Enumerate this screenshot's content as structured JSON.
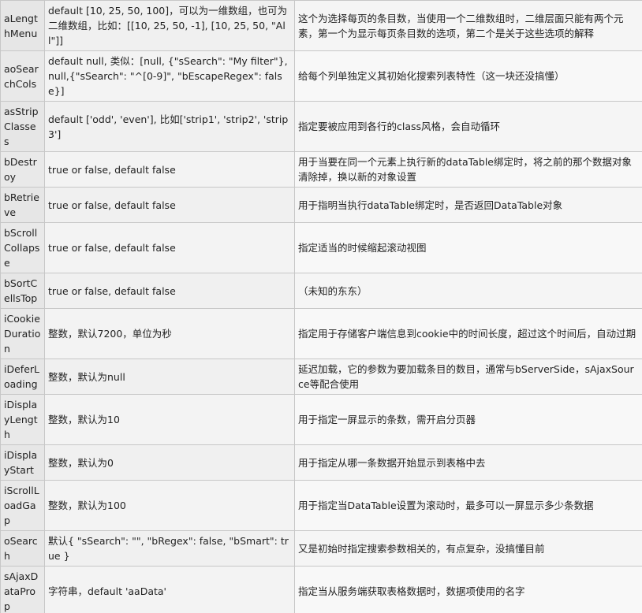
{
  "rows": [
    {
      "name": "aLengthMenu",
      "default": "default [10, 25, 50, 100]，可以为一维数组，也可为二维数组，比如：[[10, 25, 50, -1], [10, 25, 50, \"All\"]]",
      "desc": "这个为选择每页的条目数，当使用一个二维数组时，二维层面只能有两个元素，第一个为显示每页条目数的选项，第二个是关于这些选项的解释"
    },
    {
      "name": "aoSearchCols",
      "default": "default null, 类似：[null, {\"sSearch\": \"My filter\"}, null,{\"sSearch\": \"^[0-9]\", \"bEscapeRegex\": false}]",
      "desc": "给每个列单独定义其初始化搜索列表特性（这一块还没搞懂）"
    },
    {
      "name": "asStripClasses",
      "default": "default ['odd', 'even'], 比如['strip1', 'strip2', 'strip3']",
      "desc": "指定要被应用到各行的class风格，会自动循环"
    },
    {
      "name": "bDestroy",
      "default": "true or false, default false",
      "desc": "用于当要在同一个元素上执行新的dataTable绑定时，将之前的那个数据对象清除掉，换以新的对象设置"
    },
    {
      "name": "bRetrieve",
      "default": "true or false, default false",
      "desc": "用于指明当执行dataTable绑定时，是否返回DataTable对象"
    },
    {
      "name": "bScrollCollapse",
      "default": "true or false, default false",
      "desc": "指定适当的时候缩起滚动视图"
    },
    {
      "name": "bSortCellsTop",
      "default": "true or false, default false",
      "desc": "（未知的东东）"
    },
    {
      "name": "iCookieDuration",
      "default": "整数，默认7200，单位为秒",
      "desc": "指定用于存储客户端信息到cookie中的时间长度，超过这个时间后，自动过期"
    },
    {
      "name": "iDeferLoading",
      "default": "整数，默认为null",
      "desc": "延迟加载，它的参数为要加载条目的数目，通常与bServerSide，sAjaxSource等配合使用"
    },
    {
      "name": "iDisplayLength",
      "default": "整数，默认为10",
      "desc": "用于指定一屏显示的条数，需开启分页器"
    },
    {
      "name": "iDisplayStart",
      "default": "整数，默认为0",
      "desc": "用于指定从哪一条数据开始显示到表格中去"
    },
    {
      "name": "iScrollLoadGap",
      "default": "整数，默认为100",
      "desc": "用于指定当DataTable设置为滚动时，最多可以一屏显示多少条数据"
    },
    {
      "name": "oSearch",
      "default": "默认{ \"sSearch\": \"\", \"bRegex\": false, \"bSmart\": true }",
      "desc": "又是初始时指定搜索参数相关的，有点复杂，没搞懂目前"
    },
    {
      "name": "sAjaxDataProp",
      "default": "字符串，default 'aaData'",
      "desc": "指定当从服务端获取表格数据时，数据项使用的名字"
    }
  ]
}
